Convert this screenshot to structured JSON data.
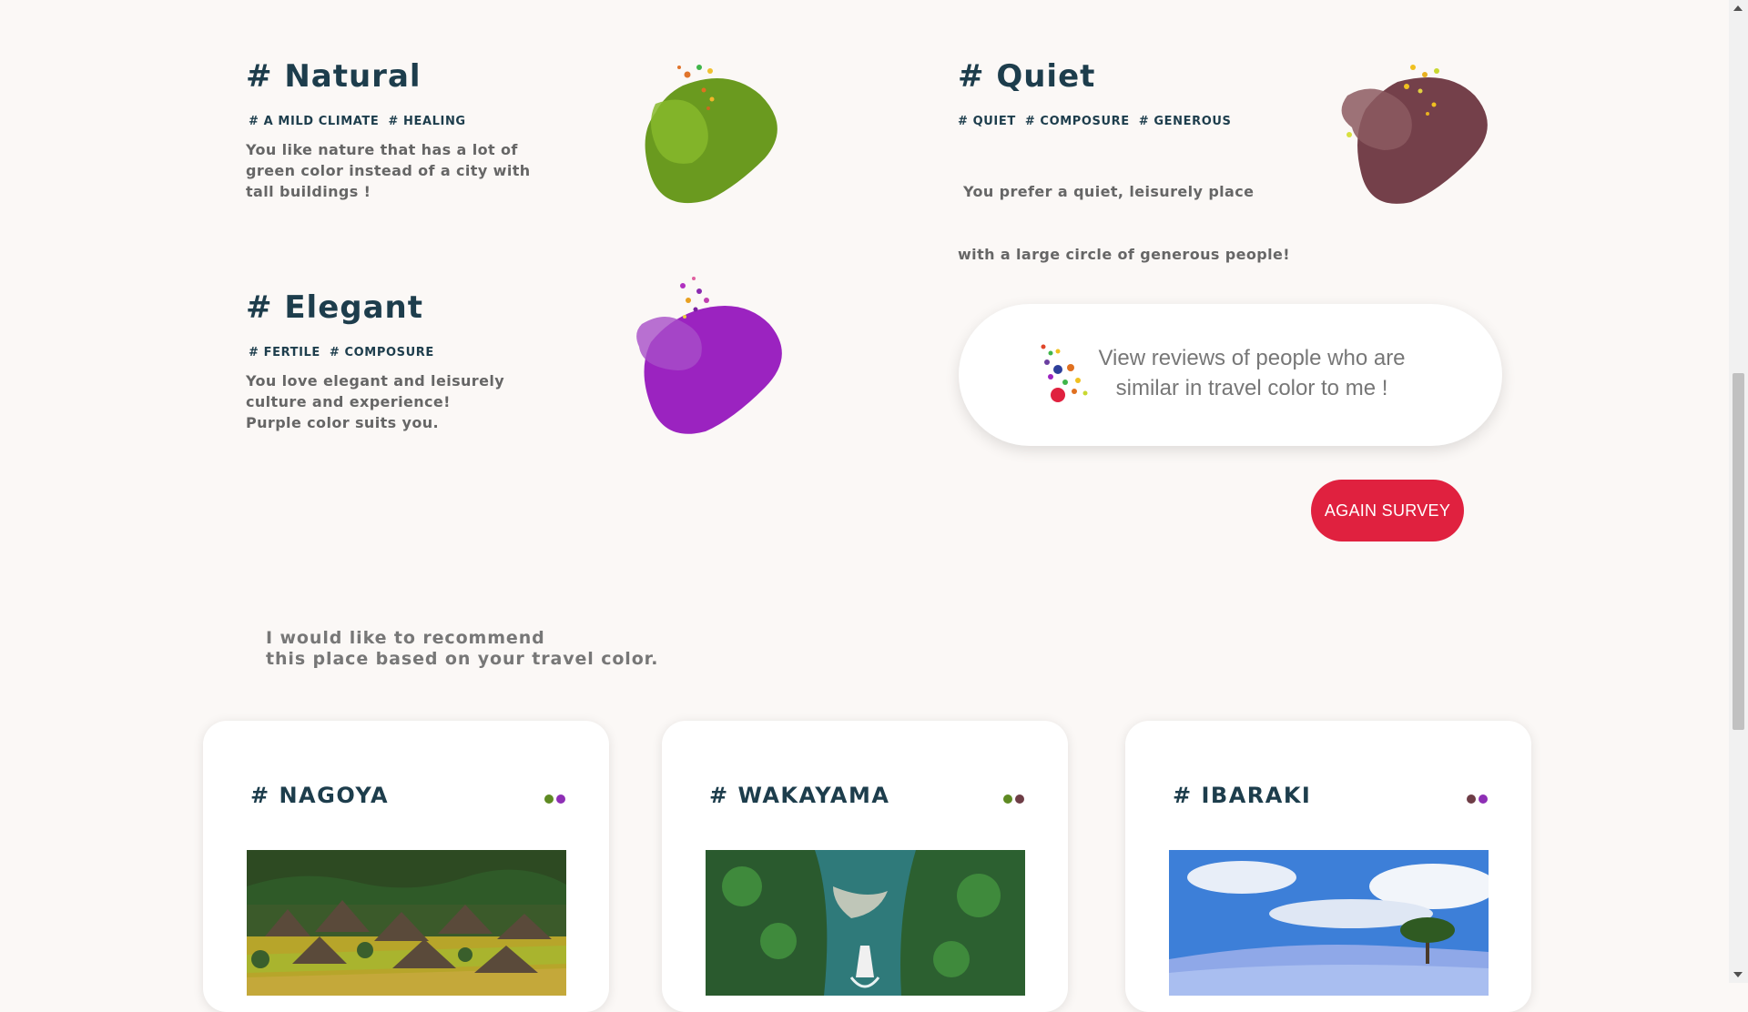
{
  "colors": [
    {
      "title": "# Natural",
      "tags": [
        "# A MILD CLIMATE",
        "# HEALING"
      ],
      "description_lines": [
        "You like nature that has a lot of",
        "green color instead of a city with",
        "tall buildings !"
      ],
      "blob_color": "#6b9a1f"
    },
    {
      "title": "# Quiet",
      "tags": [
        "# QUIET",
        "# COMPOSURE",
        "# GENEROUS"
      ],
      "description_lines": [
        " You prefer a quiet, leisurely place",
        "with a large circle of generous people!"
      ],
      "blob_color": "#74404a"
    },
    {
      "title": "# Elegant",
      "tags": [
        "# FERTILE",
        "# COMPOSURE"
      ],
      "description_lines": [
        "You love elegant and leisurely",
        "culture and experience!",
        "Purple color suits you."
      ],
      "blob_color": "#9a25c0"
    }
  ],
  "review": {
    "line1": "View reviews of people who are",
    "line2": "similar in travel color to me !"
  },
  "again_survey_label": "AGAIN SURVEY",
  "recommend": {
    "line1": "I would like to recommend",
    "line2": "this place based on your travel color."
  },
  "cards": [
    {
      "title": "# NAGOYA",
      "dot_colors": [
        "#5e8a22",
        "#8e2fb5"
      ]
    },
    {
      "title": "# WAKAYAMA",
      "dot_colors": [
        "#5e8a22",
        "#6e3d46"
      ]
    },
    {
      "title": "# IBARAKI",
      "dot_colors": [
        "#6e3d46",
        "#8e2fb5"
      ]
    }
  ],
  "icons": {
    "scroll_up": "triangle-up-icon",
    "scroll_down": "triangle-down-icon"
  }
}
